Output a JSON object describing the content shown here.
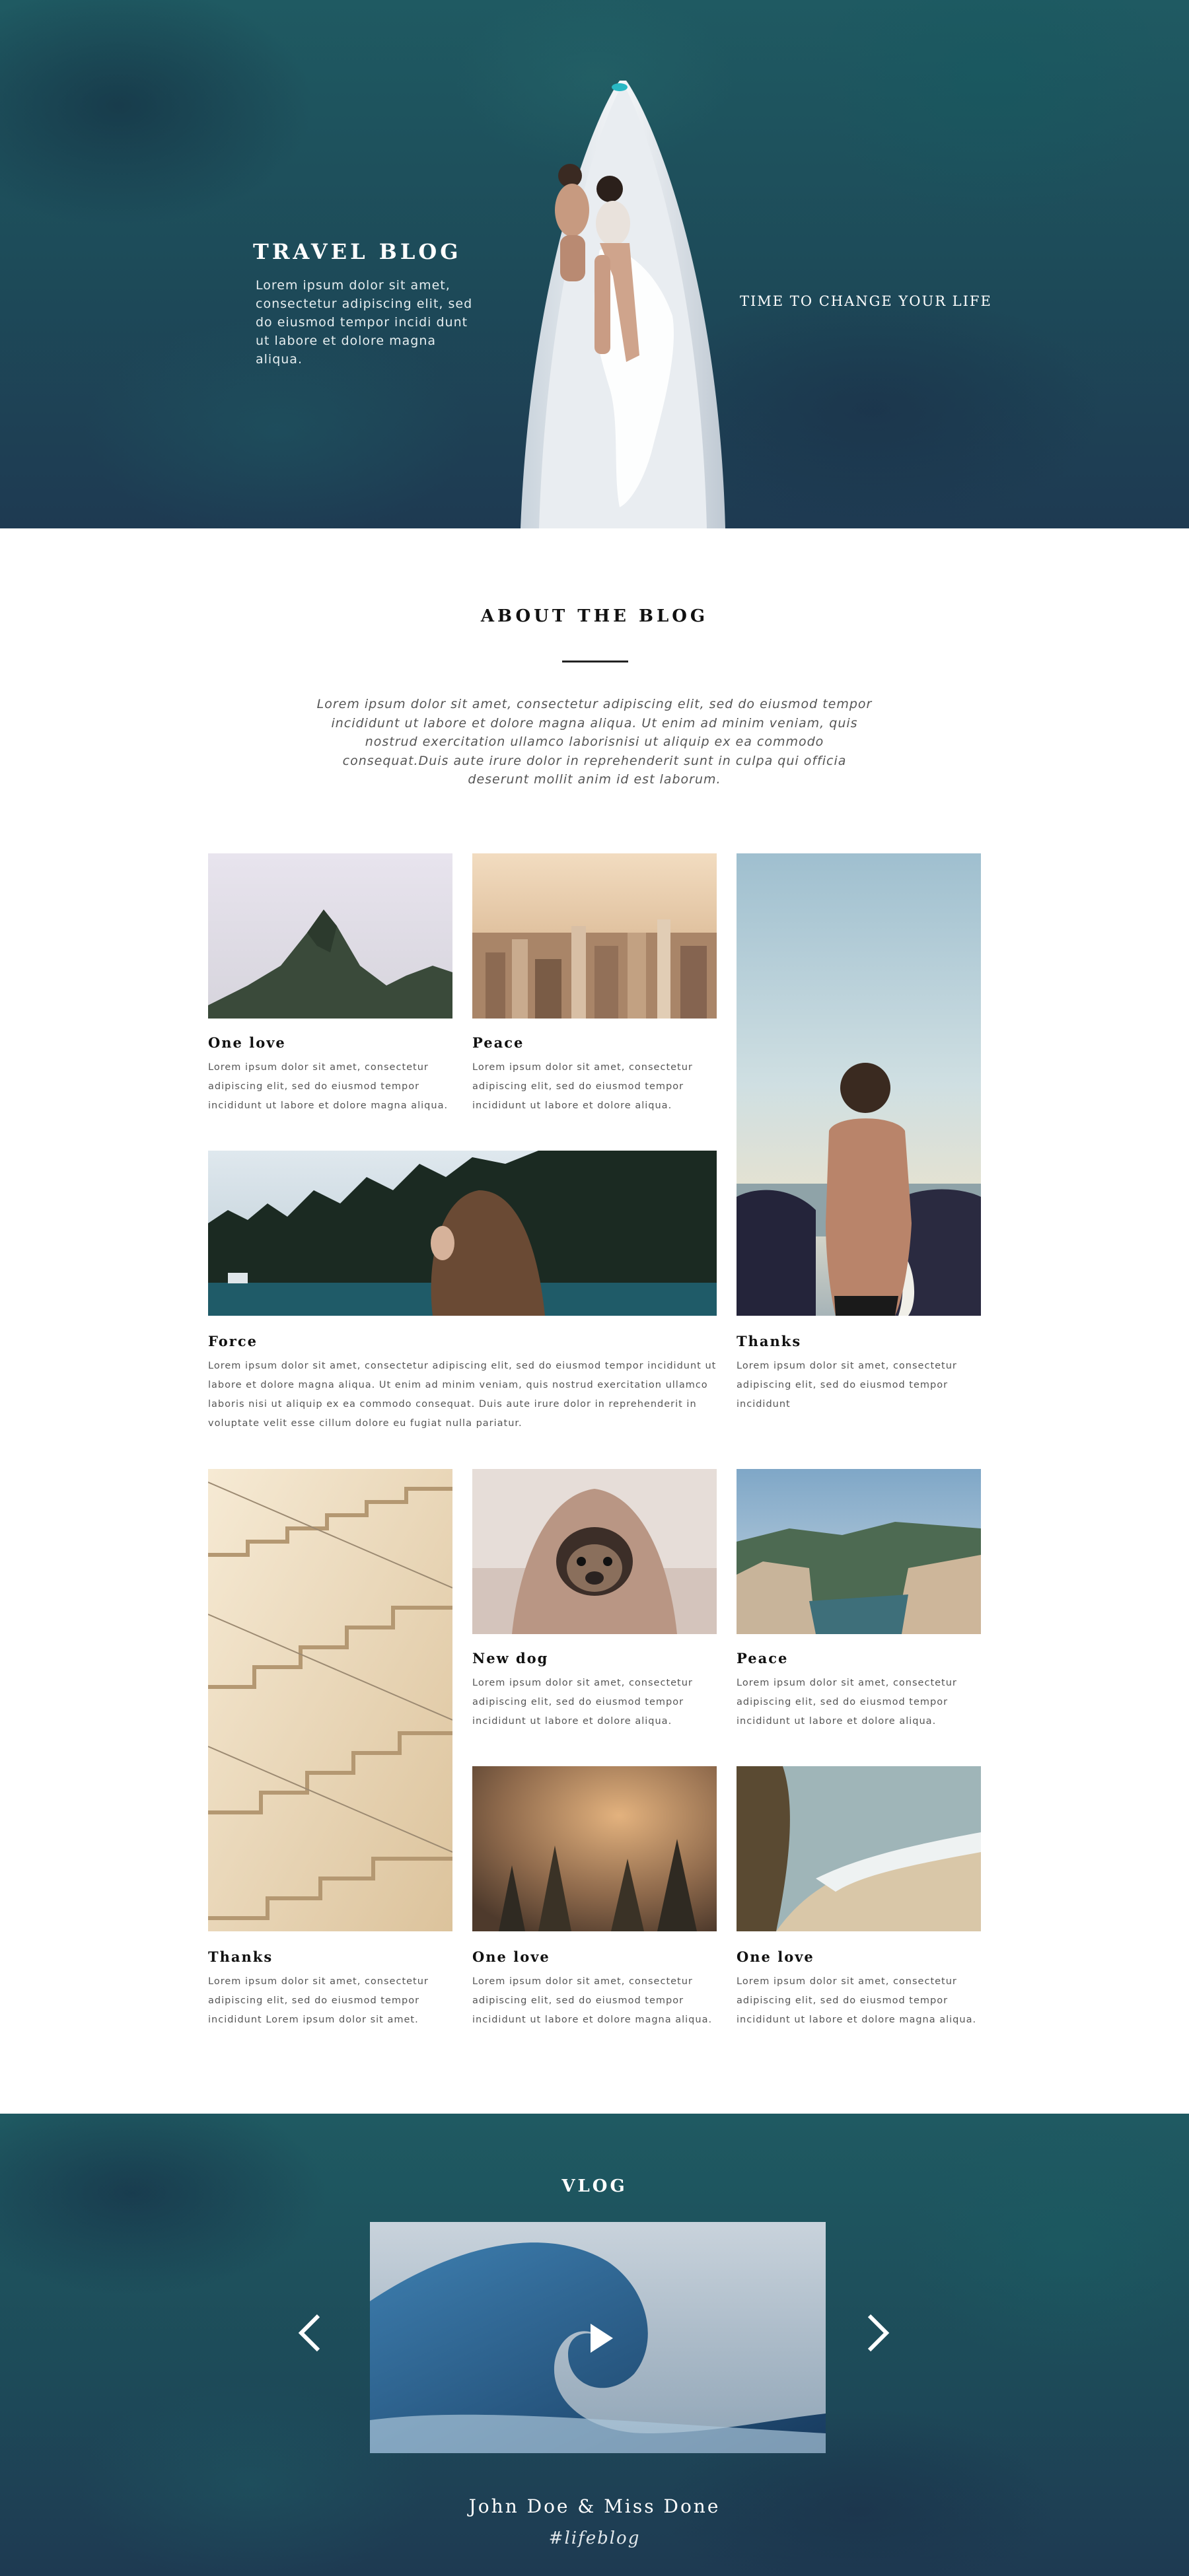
{
  "hero": {
    "title": "TRAVEL BLOG",
    "text": "Lorem ipsum dolor sit amet, consectetur adipiscing elit, sed do eiusmod tempor incidi dunt ut labore et dolore magna aliqua.",
    "tagline": "TIME TO CHANGE YOUR LIFE"
  },
  "about": {
    "title": "ABOUT THE BLOG",
    "text": "Lorem ipsum dolor sit amet, consectetur adipiscing elit, sed do eiusmod tempor incididunt ut labore et dolore magna aliqua. Ut enim ad minim veniam, quis nostrud exercitation ullamco laborisnisi ut aliquip ex ea commodo consequat.Duis aute irure dolor in reprehenderit sunt in culpa qui officia deserunt mollit anim id est laborum."
  },
  "posts": [
    {
      "title": "One love",
      "text": "Lorem ipsum dolor sit amet, consectetur adipiscing elit, sed do eiusmod tempor incididunt ut labore et dolore magna aliqua.",
      "image": "mountain-photo"
    },
    {
      "title": "Peace",
      "text": "Lorem ipsum dolor sit amet, consectetur adipiscing elit, sed do eiusmod tempor incididunt ut labore et dolore aliqua.",
      "image": "city-photo"
    },
    {
      "title": "Thanks",
      "text": "Lorem ipsum dolor sit amet, consectetur adipiscing elit, sed do eiusmod tempor incididunt",
      "image": "surfer-photo"
    },
    {
      "title": "Force",
      "text": "Lorem ipsum dolor sit amet, consectetur adipiscing elit, sed do eiusmod tempor incididunt ut labore et dolore magna aliqua. Ut enim ad minim veniam, quis nostrud exercitation ullamco laboris nisi ut aliquip ex ea commodo consequat. Duis aute irure dolor in reprehenderit in voluptate velit esse cillum dolore eu fugiat nulla pariatur.",
      "image": "lake-forest-woman-photo"
    },
    {
      "title": "Thanks",
      "text": "Lorem ipsum dolor sit amet, consectetur adipiscing elit, sed do eiusmod tempor incididunt Lorem ipsum dolor sit amet.",
      "image": "staircase-photo"
    },
    {
      "title": "New dog",
      "text": "Lorem ipsum dolor sit amet, consectetur adipiscing elit, sed do eiusmod tempor incididunt ut labore et dolore aliqua.",
      "image": "pug-blanket-photo"
    },
    {
      "title": "Peace",
      "text": "Lorem ipsum dolor sit amet, consectetur adipiscing elit, sed do eiusmod tempor incididunt ut labore et dolore aliqua.",
      "image": "coastal-cliffs-photo"
    },
    {
      "title": "One love",
      "text": "Lorem ipsum dolor sit amet, consectetur adipiscing elit, sed do eiusmod tempor incididunt ut labore et dolore magna aliqua.",
      "image": "misty-forest-photo"
    },
    {
      "title": "One love",
      "text": "Lorem ipsum dolor sit amet, consectetur adipiscing elit, sed do eiusmod tempor incididunt ut labore et dolore magna aliqua.",
      "image": "beach-cliff-photo"
    }
  ],
  "vlog": {
    "title": "VLOG",
    "names": "John Doe & Miss Done",
    "hashtag": "#lifeblog",
    "video": "ocean-wave-video",
    "prev_icon": "chevron-left-icon",
    "next_icon": "chevron-right-icon",
    "play_icon": "play-icon"
  }
}
